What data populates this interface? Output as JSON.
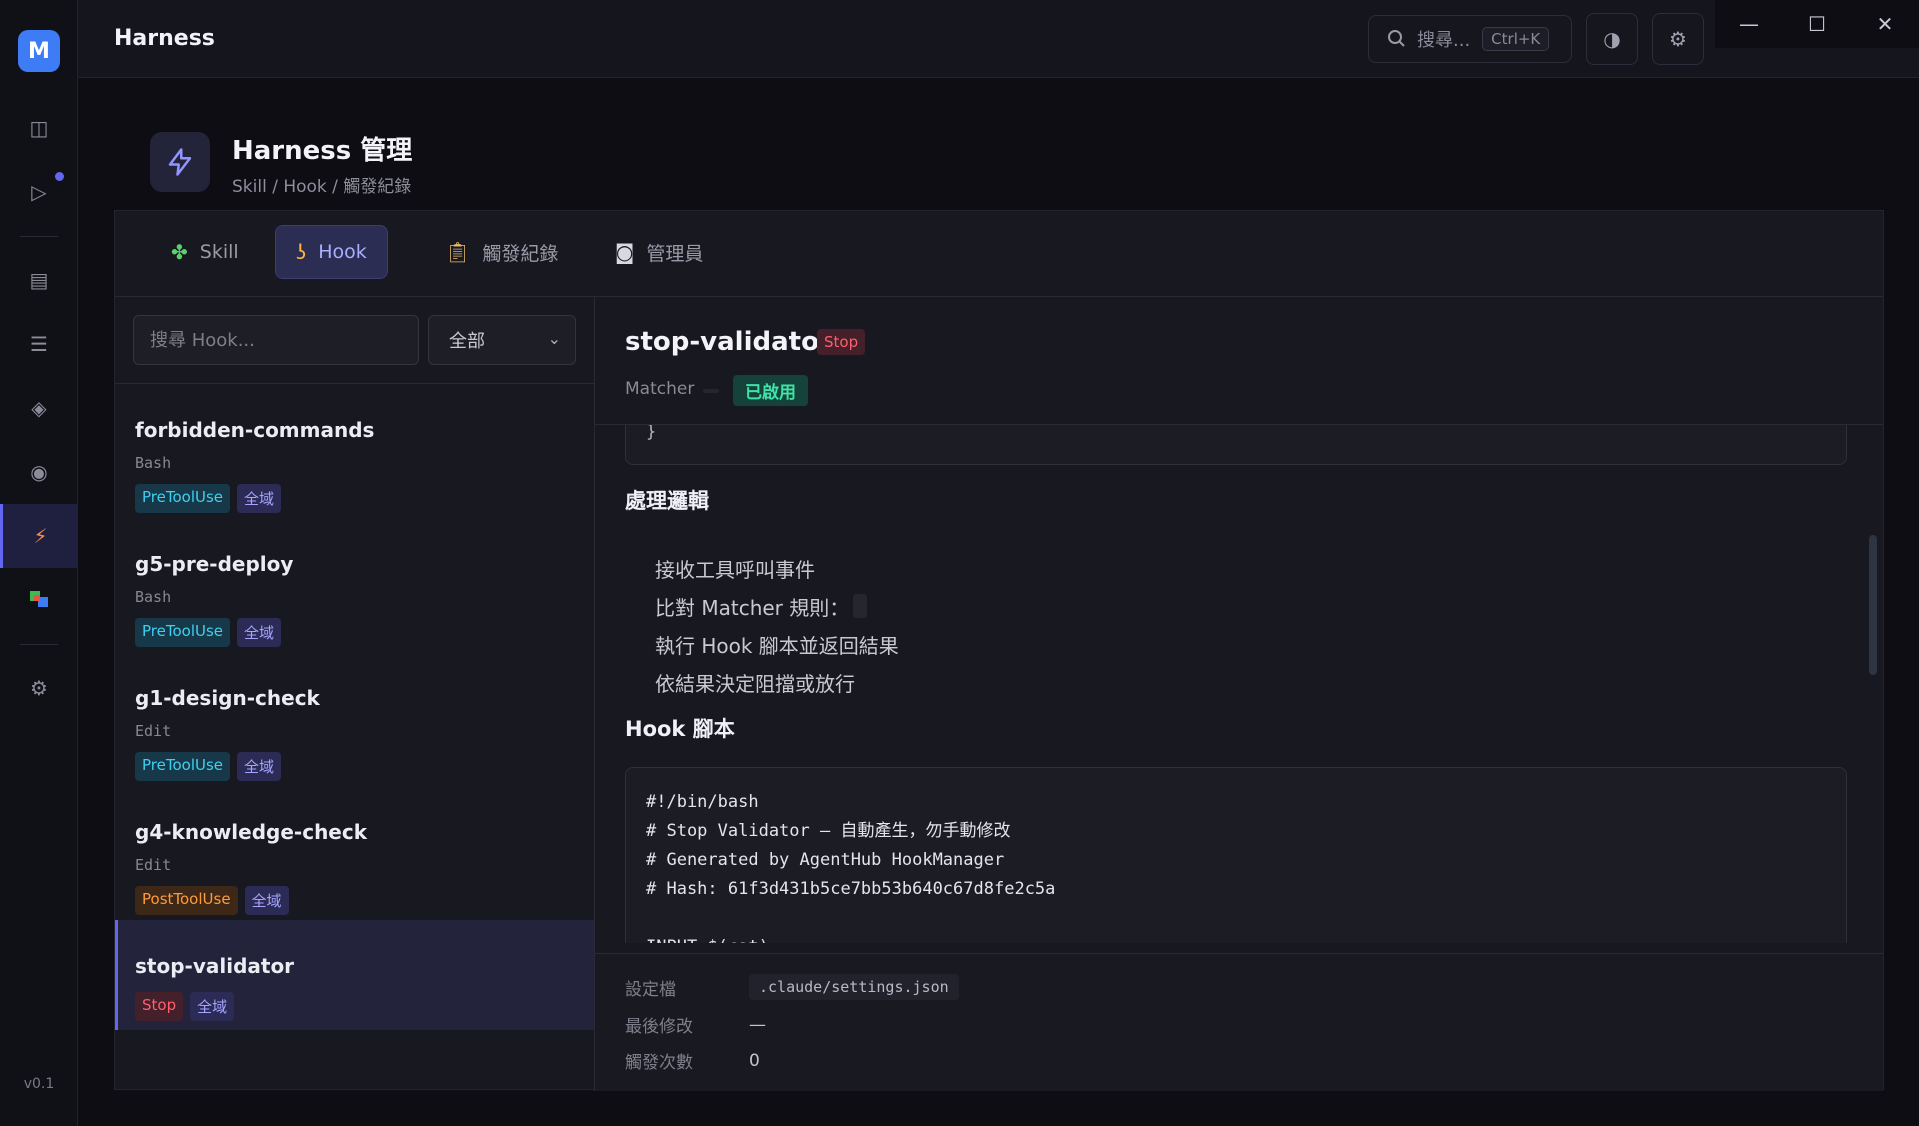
{
  "app": {
    "title": "Harness",
    "version": "v0.1",
    "logo_letter": "M"
  },
  "topbar": {
    "search_placeholder": "搜尋...",
    "search_shortcut": "Ctrl+K"
  },
  "page": {
    "title": "Harness 管理",
    "subtitle": "Skill / Hook / 觸發紀錄"
  },
  "tabs": [
    {
      "label": "Skill",
      "icon": "puzzle-icon"
    },
    {
      "label": "Hook",
      "icon": "hook-icon",
      "active": true
    },
    {
      "label": "觸發紀錄",
      "icon": "clipboard-icon"
    },
    {
      "label": "管理員",
      "icon": "robot-icon"
    }
  ],
  "list": {
    "search_placeholder": "搜尋 Hook...",
    "filter_value": "全部",
    "items": [
      {
        "name": "forbidden-commands",
        "matcher": "Bash",
        "event": "PreToolUse",
        "scope": "全域"
      },
      {
        "name": "g5-pre-deploy",
        "matcher": "Bash",
        "event": "PreToolUse",
        "scope": "全域"
      },
      {
        "name": "g1-design-check",
        "matcher": "Edit",
        "event": "PreToolUse",
        "scope": "全域"
      },
      {
        "name": "g4-knowledge-check",
        "matcher": "Edit",
        "event": "PostToolUse",
        "scope": "全域"
      },
      {
        "name": "stop-validator",
        "matcher": "",
        "event": "Stop",
        "scope": "全域",
        "selected": true
      }
    ]
  },
  "detail": {
    "name": "stop-validator",
    "event": "Stop",
    "matcher_label": "Matcher",
    "status": "已啟用",
    "code_tail": "}",
    "logic_title": "處理邏輯",
    "steps": [
      "接收工具呼叫事件",
      "比對 Matcher 規則：",
      "執行 Hook 腳本並返回結果",
      "依結果決定阻擋或放行"
    ],
    "script_title": "Hook 腳本",
    "script_lines": [
      "#!/bin/bash",
      "# Stop Validator — 自動產生，勿手動修改",
      "# Generated by AgentHub HookManager",
      "# Hash: 61f3d431b5ce7bb53b640c67d8fe2c5a",
      "",
      "INPUT=$(cat)"
    ],
    "meta": {
      "config_label": "設定檔",
      "config_value": ".claude/settings.json",
      "modified_label": "最後修改",
      "modified_value": "—",
      "count_label": "觸發次數",
      "count_value": "0"
    }
  },
  "colors": {
    "accent": "#6366f1",
    "pre_tool_use": "#3fd0f0",
    "post_tool_use": "#ff9a3c",
    "stop": "#ff5f6d",
    "enabled": "#3fe2a8"
  }
}
